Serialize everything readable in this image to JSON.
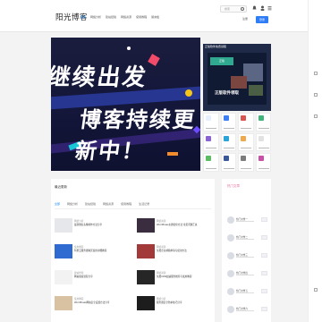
{
  "header": {
    "logo": "阳光博客",
    "nav": [
      "首页",
      "网络分析",
      "建站经验",
      "网络资源",
      "使用教程",
      "留言板"
    ],
    "search_placeholder": "搜索",
    "register_label": "注册",
    "login_label": "登录"
  },
  "banner": {
    "line1": "继续出发",
    "line2": "博客持续更新中！"
  },
  "promo": {
    "header": "正版软件免费领取",
    "tag": "正版",
    "title": "正版软件领取"
  },
  "tiles": [
    {
      "color": "#e8f0ff"
    },
    {
      "color": "#3d7df6"
    },
    {
      "color": "#d9534f"
    },
    {
      "color": "#40b57a"
    },
    {
      "color": "#8a63d2"
    },
    {
      "color": "#2aa3d6"
    },
    {
      "color": "#f0a84a"
    },
    {
      "color": "#e2e2e2"
    },
    {
      "color": "#5dbb63"
    },
    {
      "color": "#3b5998"
    },
    {
      "color": "#7b7b7b"
    },
    {
      "color": "#c94fa8"
    }
  ],
  "articles": {
    "title": "最近更新",
    "tabs": [
      "全部",
      "网络分析",
      "建站经验",
      "网络资源",
      "使用教程",
      "生活记录"
    ],
    "items": [
      {
        "cat": "网络分析",
        "title": "最新微信头像制作方法分享",
        "thumb": "#e5e7eb"
      },
      {
        "cat": "网络资源",
        "title": "WordPress主题优化方法 常见问题汇总",
        "thumb": "#3a2d3f"
      },
      {
        "cat": "使用教程",
        "title": "阿里云服务器购买使用详细教程",
        "thumb": "#2f6bd1"
      },
      {
        "cat": "网络资源",
        "title": "免费企业邮箱申请与使用方法",
        "thumb": "#a33a3a"
      },
      {
        "cat": "建站经验",
        "title": "网站备案流程分享",
        "thumb": "#f2f2f2"
      },
      {
        "cat": "网络资源",
        "title": "免费CDN加速服务推荐与使用教程",
        "thumb": "#262626"
      },
      {
        "cat": "使用教程",
        "title": "WordPress网站安全设置方法分享",
        "thumb": "#d9c2a1"
      },
      {
        "cat": "网络分析",
        "title": "服务器安全防护技巧分享",
        "thumb": "#1d1d1d"
      }
    ]
  },
  "sidebar": {
    "title": "热门文章",
    "rows": [
      {
        "name": "热门文章一"
      },
      {
        "name": "热门文章二"
      },
      {
        "name": "热门文章三"
      },
      {
        "name": "热门文章四"
      },
      {
        "name": "热门文章五"
      },
      {
        "name": "热门文章六"
      }
    ]
  }
}
